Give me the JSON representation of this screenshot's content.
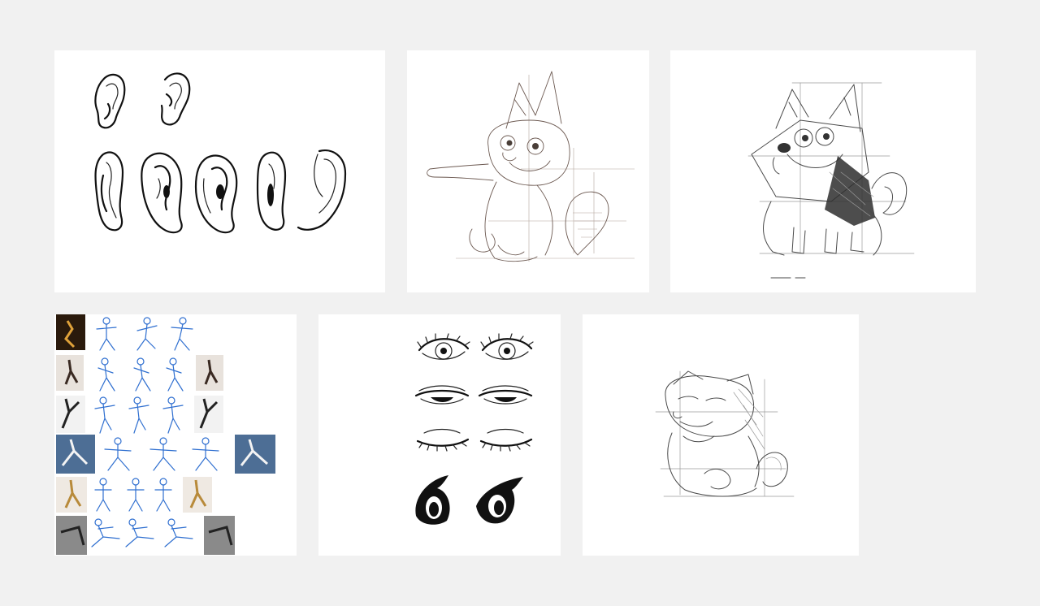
{
  "gallery": {
    "background": "#f1f1f1",
    "card_background": "#ffffff",
    "cards": [
      {
        "id": "ears",
        "subject": "ear-studies"
      },
      {
        "id": "fox-sketch",
        "subject": "cartoon-fox-construction-sketch"
      },
      {
        "id": "husky-sketch",
        "subject": "cartoon-husky-construction-sketch"
      },
      {
        "id": "poses",
        "subject": "gesture-figure-studies"
      },
      {
        "id": "eyes",
        "subject": "eye-studies"
      },
      {
        "id": "cat-sketch",
        "subject": "cartoon-cat-construction-sketch"
      }
    ],
    "colors": {
      "gesture_lines": "#2f6fd0",
      "pencil_brown": "#6d5a52",
      "pencil_gray": "#4a4a4a",
      "ink": "#111111"
    }
  }
}
